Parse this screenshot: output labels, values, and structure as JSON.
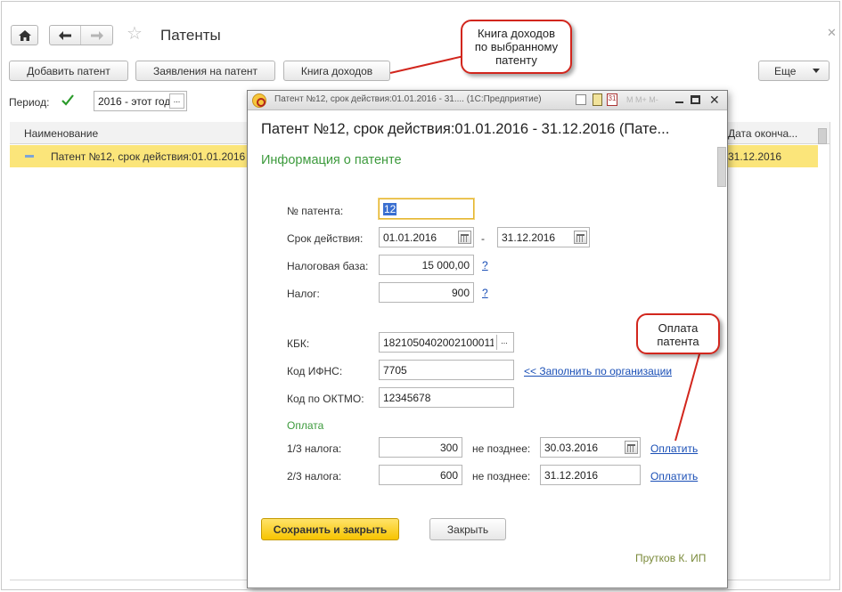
{
  "window": {
    "title": "Патенты",
    "nav": {
      "home_icon": "home-icon",
      "back_icon": "arrow-left-icon",
      "forward_icon": "arrow-right-icon"
    }
  },
  "toolbar": {
    "add_patent": "Добавить патент",
    "applications": "Заявления на патент",
    "income_book": "Книга доходов",
    "more": "Еще"
  },
  "filter": {
    "period_label": "Период:",
    "period_value": "2016 - этот год",
    "select_btn": "..."
  },
  "table": {
    "headers": {
      "name": "Наименование",
      "end_date": "Дата оконча..."
    },
    "rows": [
      {
        "name": "Патент №12, срок действия:01.01.2016",
        "end_date": "31.12.2016"
      }
    ]
  },
  "dialog": {
    "window_title": "Патент №12, срок действия:01.01.2016 - 31....  (1С:Предприятие)",
    "heading": "Патент №12, срок действия:01.01.2016 - 31.12.2016 (Пате...",
    "section_title": "Информация о патенте",
    "fields": {
      "patent_no_label": "№ патента:",
      "patent_no_value": "12",
      "validity_label": "Срок действия:",
      "validity_from": "01.01.2016",
      "validity_dash": "-",
      "validity_to": "31.12.2016",
      "tax_base_label": "Налоговая база:",
      "tax_base_value": "15 000,00",
      "tax_label": "Налог:",
      "tax_value": "900",
      "help": "?",
      "kbk_label": "КБК:",
      "kbk_value": "18210504020021000110",
      "ifns_label": "Код ИФНС:",
      "ifns_value": "7705",
      "fill_link": "<< Заполнить по организации",
      "oktmo_label": "Код по ОКТМО:",
      "oktmo_value": "12345678"
    },
    "payment": {
      "title": "Оплата",
      "rows": [
        {
          "label": "1/3 налога:",
          "amount": "300",
          "not_later": "не позднее:",
          "date": "30.03.2016",
          "link": "Оплатить"
        },
        {
          "label": "2/3 налога:",
          "amount": "600",
          "not_later": "не позднее:",
          "date": "31.12.2016",
          "link": "Оплатить"
        }
      ]
    },
    "buttons": {
      "save_close": "Сохранить и закрыть",
      "close": "Закрыть"
    },
    "footer": "Прутков К. ИП"
  },
  "callouts": {
    "income_book": [
      "Книга доходов",
      "по выбранному",
      "патенту"
    ],
    "payment": [
      "Оплата",
      "патента"
    ]
  },
  "colors": {
    "selected_row": "#fbe57a",
    "accent_green": "#3c9a3c",
    "link": "#1a4fb6",
    "callout_border": "#d2261d",
    "primary_button": "#f7c400"
  }
}
